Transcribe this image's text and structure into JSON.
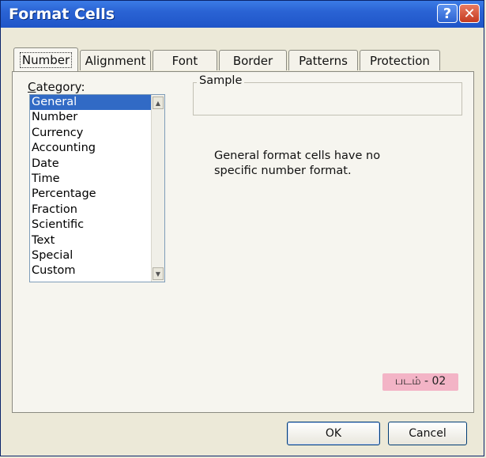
{
  "window": {
    "title": "Format Cells"
  },
  "titlebar": {
    "help_glyph": "?",
    "close_glyph": "✕"
  },
  "tabs": [
    {
      "label": "Number",
      "active": true
    },
    {
      "label": "Alignment"
    },
    {
      "label": "Font"
    },
    {
      "label": "Border"
    },
    {
      "label": "Patterns"
    },
    {
      "label": "Protection"
    }
  ],
  "category": {
    "label_first": "C",
    "label_rest": "ategory:",
    "items": [
      "General",
      "Number",
      "Currency",
      "Accounting",
      "Date",
      "Time",
      "Percentage",
      "Fraction",
      "Scientific",
      "Text",
      "Special",
      "Custom"
    ],
    "selected": "General"
  },
  "sample": {
    "label": "Sample",
    "value": ""
  },
  "description": "General format cells have no specific number format.",
  "figure_label": "படம் - 02",
  "buttons": {
    "ok": "OK",
    "cancel": "Cancel"
  },
  "colors": {
    "titlebar": "#2a63d4",
    "selection": "#316ac5",
    "figure_label_bg": "#f3b4c6"
  }
}
